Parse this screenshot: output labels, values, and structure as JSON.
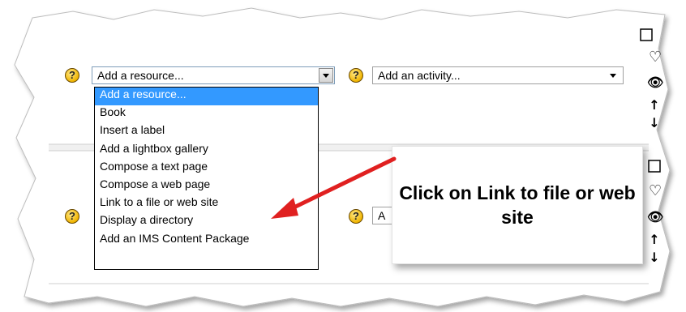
{
  "row1": {
    "resource_select_value": "Add a resource...",
    "activity_select_value": "Add an activity...",
    "help_glyph": "?"
  },
  "row2": {
    "activity_select_partial": "A",
    "help_glyph": "?"
  },
  "dropdown": {
    "options": [
      "Add a resource...",
      "Book",
      "Insert a label",
      "Add a lightbox gallery",
      "Compose a text page",
      "Compose a web page",
      "Link to a file or web site",
      "Display a directory",
      "Add an IMS Content Package"
    ],
    "highlighted_index": 0
  },
  "callout": {
    "text": "Click on Link to file or web site"
  },
  "side_icons": [
    "lightbulb-icon",
    "eye-icon",
    "move-up-arrow-icon",
    "move-down-arrow-icon",
    "checkbox-icon"
  ],
  "colors": {
    "highlight": "#3399ff",
    "arrow": "#e02020",
    "select_border": "#7f9db9"
  }
}
